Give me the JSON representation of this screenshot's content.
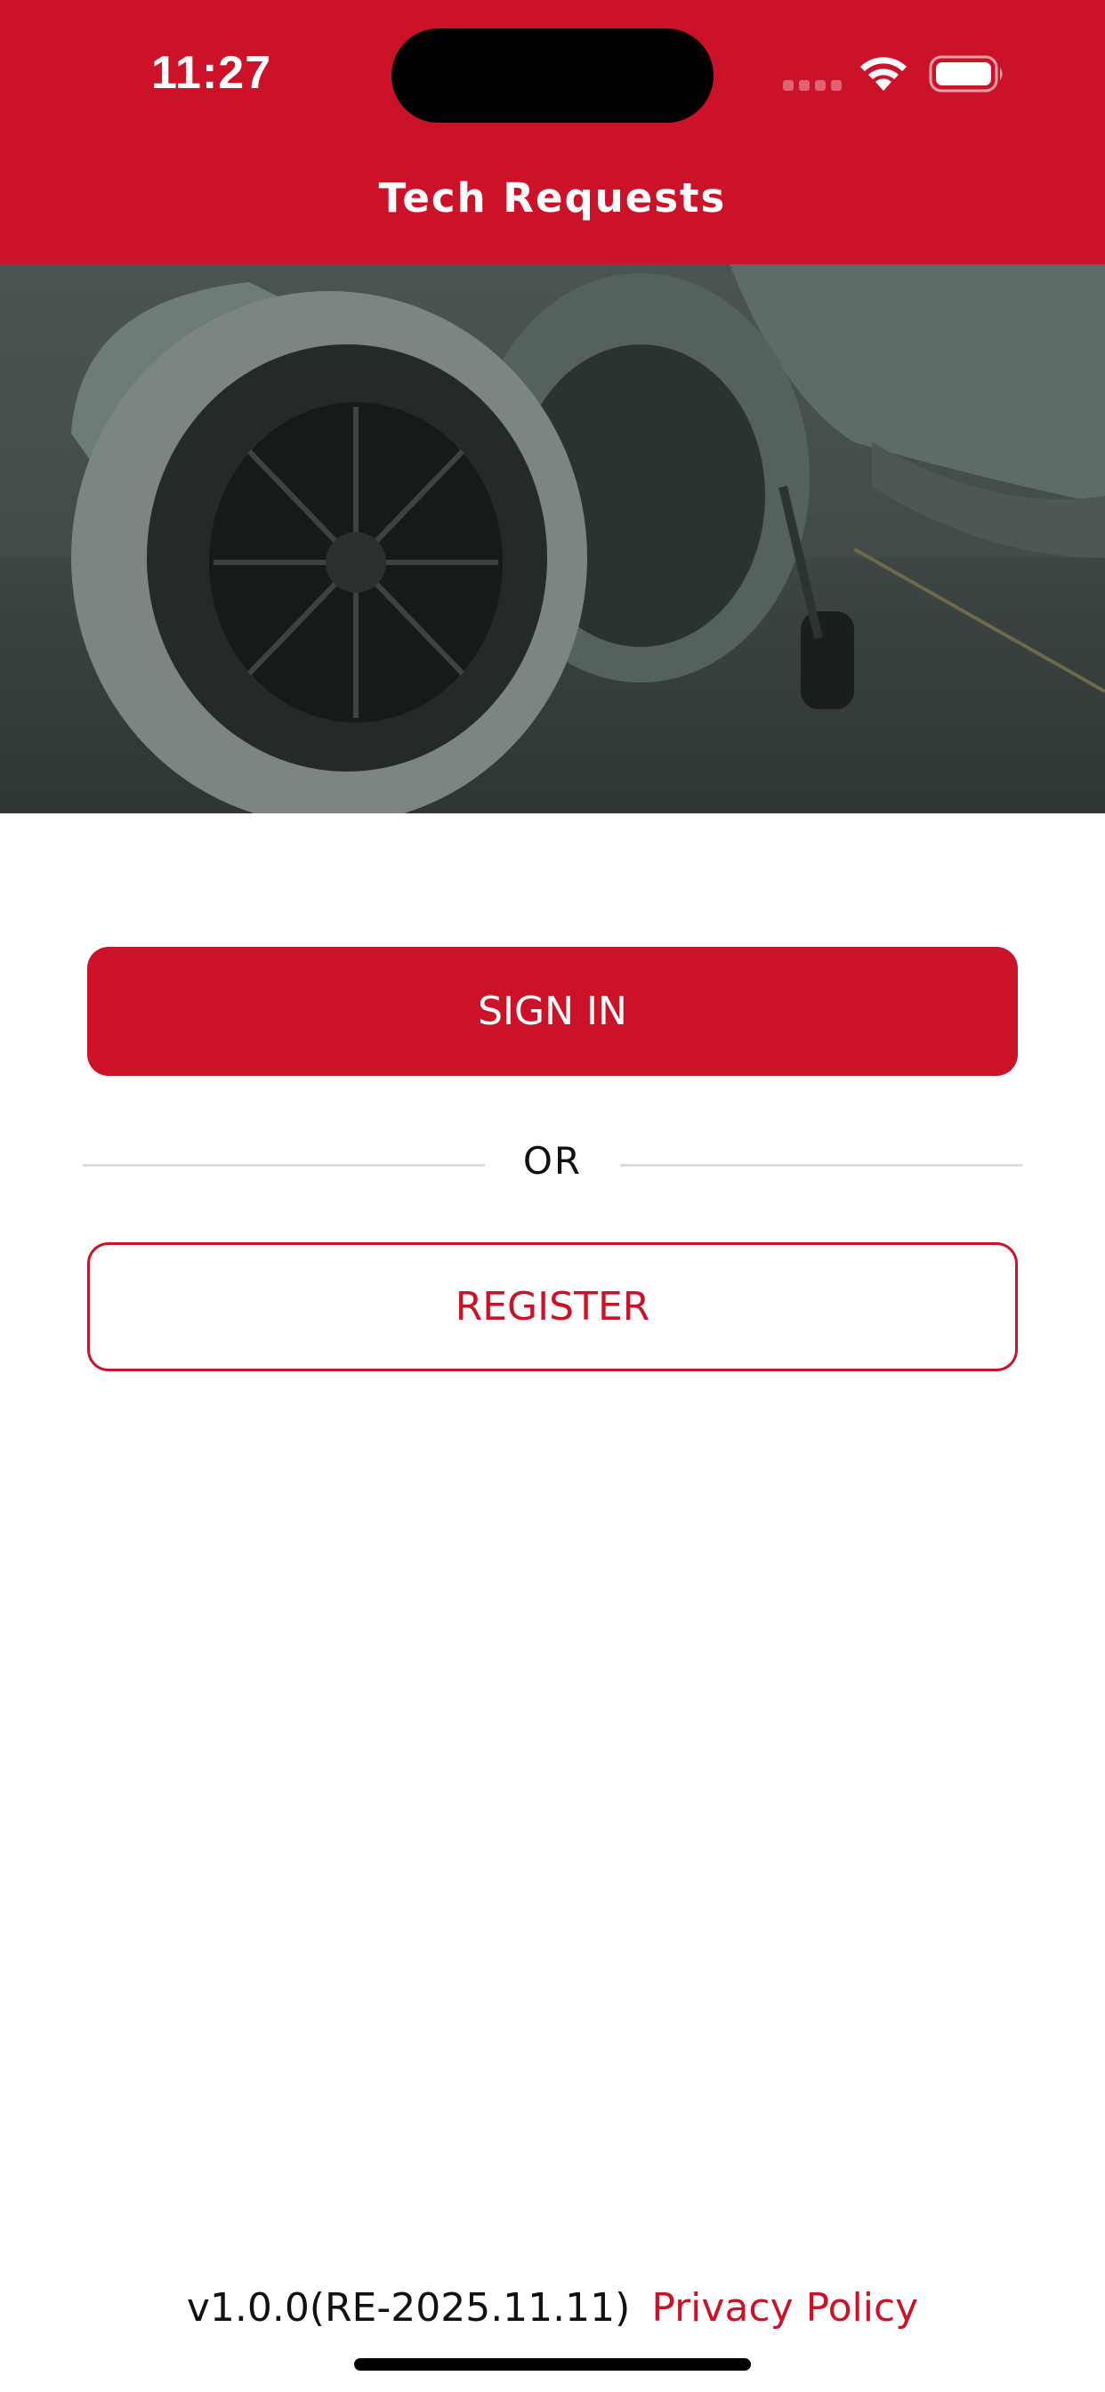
{
  "status_bar": {
    "time": "11:27"
  },
  "header": {
    "title": "Tech Requests",
    "background_color": "#cc1229"
  },
  "hero": {
    "icon": "aircraft-engine-photo"
  },
  "actions": {
    "sign_in_label": "SIGN IN",
    "or_label": "OR",
    "register_label": "REGISTER"
  },
  "footer": {
    "version": "v1.0.0(RE-2025.11.11)",
    "privacy_label": "Privacy Policy"
  },
  "colors": {
    "accent": "#cc1229",
    "divider": "#dcdcdc"
  }
}
